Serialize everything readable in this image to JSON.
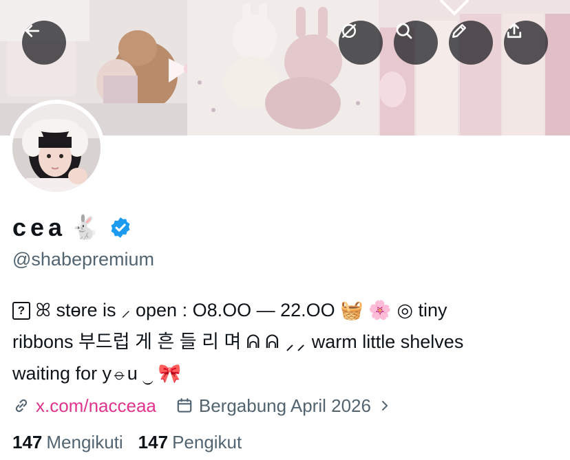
{
  "header": {
    "back_icon": "arrow-left-icon",
    "grok_icon": "grok-icon",
    "search_icon": "search-icon",
    "edit_icon": "pencil-icon",
    "share_icon": "share-icon"
  },
  "profile": {
    "display_name": "cea",
    "name_emoji": "🐇",
    "verified": true,
    "handle": "@shabepremium",
    "bio_lines": [
      "ꕤ stɵre is ⸝ open : O8.OO — 22.OO",
      "ribbons 부드럽 게 흔 들 리 며 ᕱ ᕱ ⸝⸝ warm little shelves",
      "waiting for y⦵u ⏝ 🎀"
    ],
    "bio_emojis": {
      "basket": "🧺",
      "blossom": "🌸",
      "ring": "◎",
      "ribbon": "🎀"
    },
    "link_text": "x.com/nacceaa",
    "joined_text": "Bergabung April 2026",
    "following_count": "147",
    "following_label": "Mengikuti",
    "followers_count": "147",
    "followers_label": "Pengikut"
  },
  "colors": {
    "accent": "#e0338c",
    "verified": "#1d9bf0",
    "muted": "#536471",
    "text": "#0f1419"
  }
}
